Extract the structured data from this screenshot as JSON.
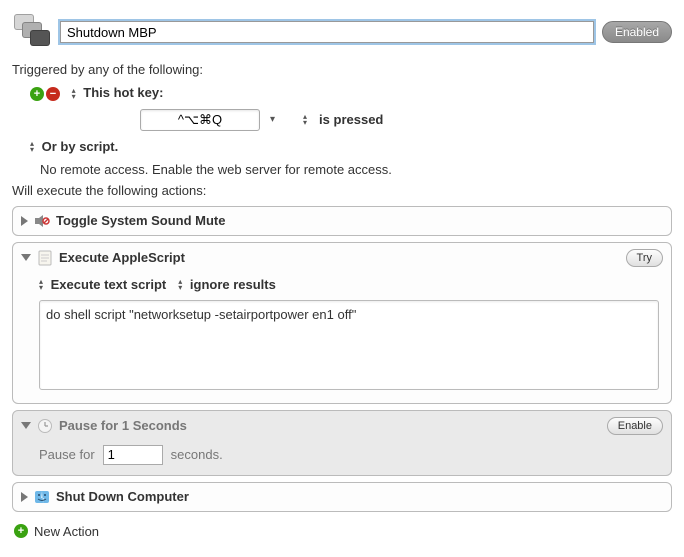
{
  "header": {
    "name_value": "Shutdown MBP",
    "enabled_label": "Enabled"
  },
  "triggers": {
    "section_label": "Triggered by any of the following:",
    "hotkey_label": "This hot key:",
    "hotkey_value": "^⌥⌘Q",
    "pressed_label": "is pressed",
    "or_script_label": "Or by script.",
    "remote_note": "No remote access.  Enable the web server for remote access."
  },
  "actions_label": "Will execute the following actions:",
  "actions": {
    "toggle_mute": {
      "title": "Toggle System Sound Mute"
    },
    "applescript": {
      "title": "Execute AppleScript",
      "try_label": "Try",
      "mode_label": "Execute text script",
      "results_label": "ignore results",
      "script_text": "do shell script \"networksetup -setairportpower en1 off\""
    },
    "pause": {
      "title": "Pause for 1 Seconds",
      "enable_label": "Enable",
      "prefix": "Pause for",
      "value": "1",
      "suffix": "seconds."
    },
    "shutdown": {
      "title": "Shut Down Computer"
    }
  },
  "new_action_label": "New Action"
}
